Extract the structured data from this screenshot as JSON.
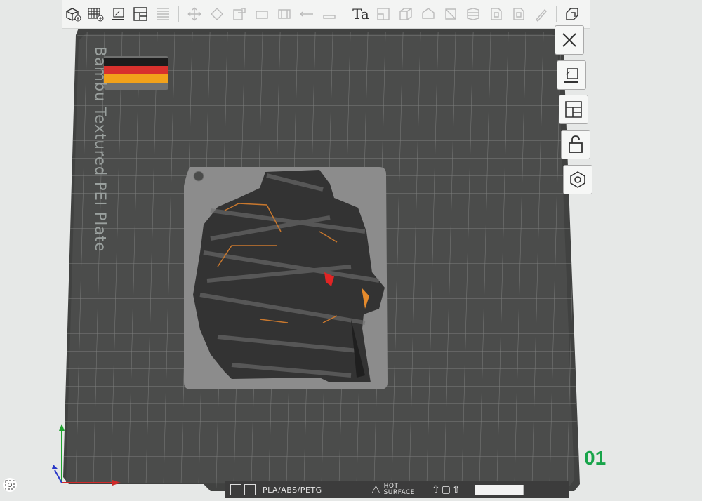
{
  "plate": {
    "label": "Bambu Textured PEI Plate",
    "number": "01"
  },
  "bottom_bar": {
    "filament": "PLA/ABS/PETG",
    "warning_line1": "HOT",
    "warning_line2": "SURFACE"
  },
  "toolbar": {
    "text_tool_label": "Ta",
    "icons": [
      "add-object-icon",
      "add-plate-icon",
      "auto-orient-icon",
      "arrange-icon",
      "split-icon",
      "move-icon",
      "rotate-icon",
      "scale-icon",
      "cut-icon",
      "text-icon",
      "support-paint-icon",
      "seam-paint-icon",
      "measure-icon",
      "assembly-icon",
      "layers-icon",
      "color-paint-icon",
      "variable-layer-icon",
      "paint-brush-icon",
      "settings-icon"
    ]
  },
  "side_buttons": [
    "close-icon",
    "auto-orient-plate-icon",
    "arrange-plate-icon",
    "lock-plate-icon",
    "plate-settings-icon"
  ],
  "colors": {
    "plate": "#4a4b4a",
    "grid": "#7c7d7c",
    "model": "#8c8c8c",
    "flag_black": "#1c1c1c",
    "flag_red": "#d8312d",
    "flag_gold": "#f2a21a",
    "accent_green": "#18a44a"
  }
}
